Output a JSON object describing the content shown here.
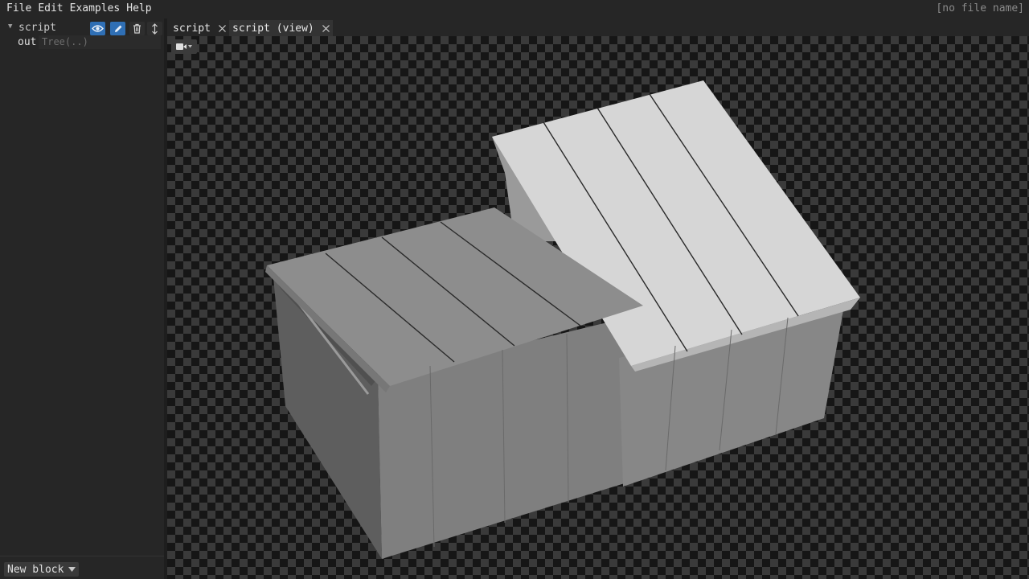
{
  "menu": {
    "file": "File",
    "edit": "Edit",
    "examples": "Examples",
    "help": "Help"
  },
  "file_name": "[no file name]",
  "block": {
    "name": "script",
    "output_label": "out",
    "output_value": "Tree(..)"
  },
  "new_block_label": "New block",
  "tabs": [
    {
      "label": "script"
    },
    {
      "label": "script (view)",
      "active": true
    }
  ],
  "colors": {
    "accent": "#2f6fb5",
    "background": "#262626"
  }
}
